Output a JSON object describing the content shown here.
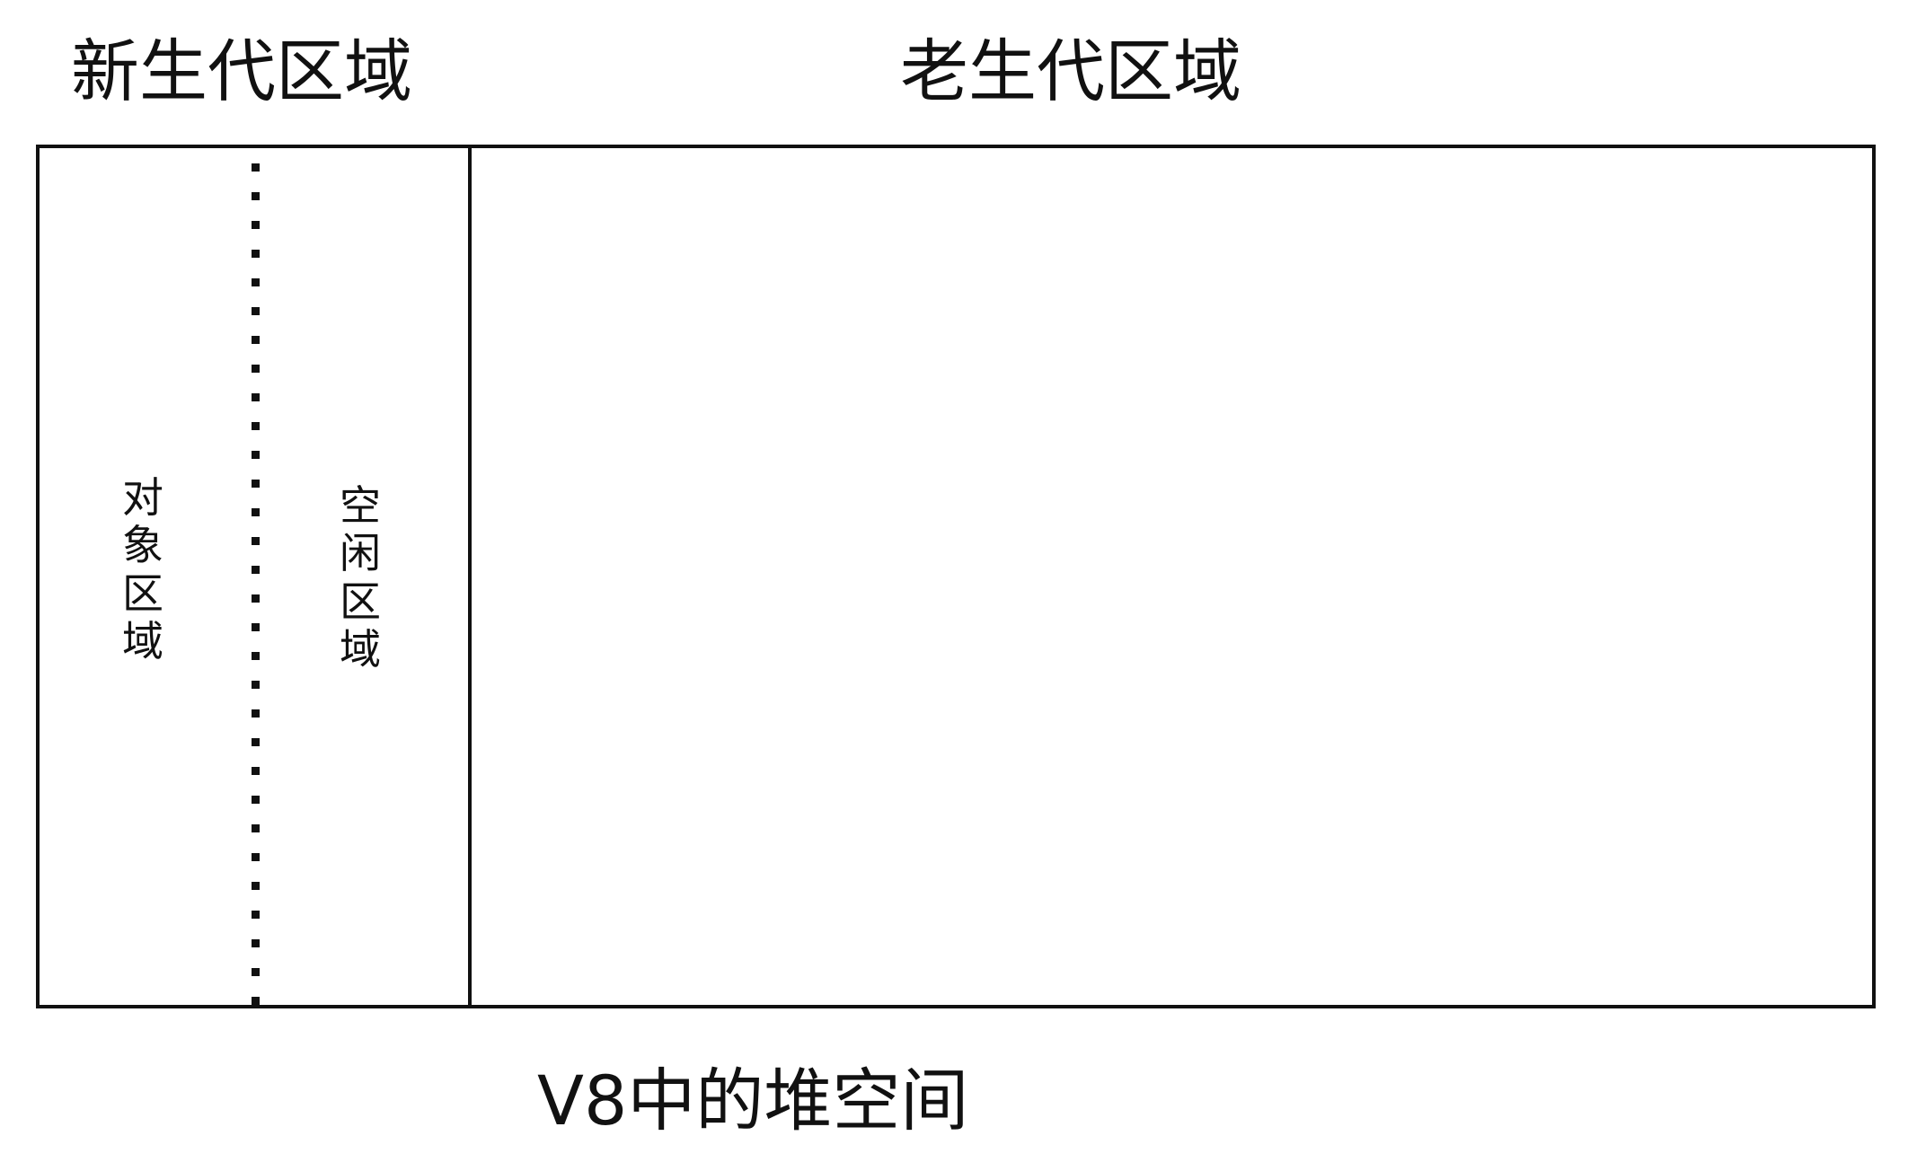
{
  "diagram": {
    "young_generation_label": "新生代区域",
    "old_generation_label": "老生代区域",
    "object_space_label": "对象区域",
    "free_space_label": "空闲区域",
    "caption": "V8中的堆空间"
  }
}
